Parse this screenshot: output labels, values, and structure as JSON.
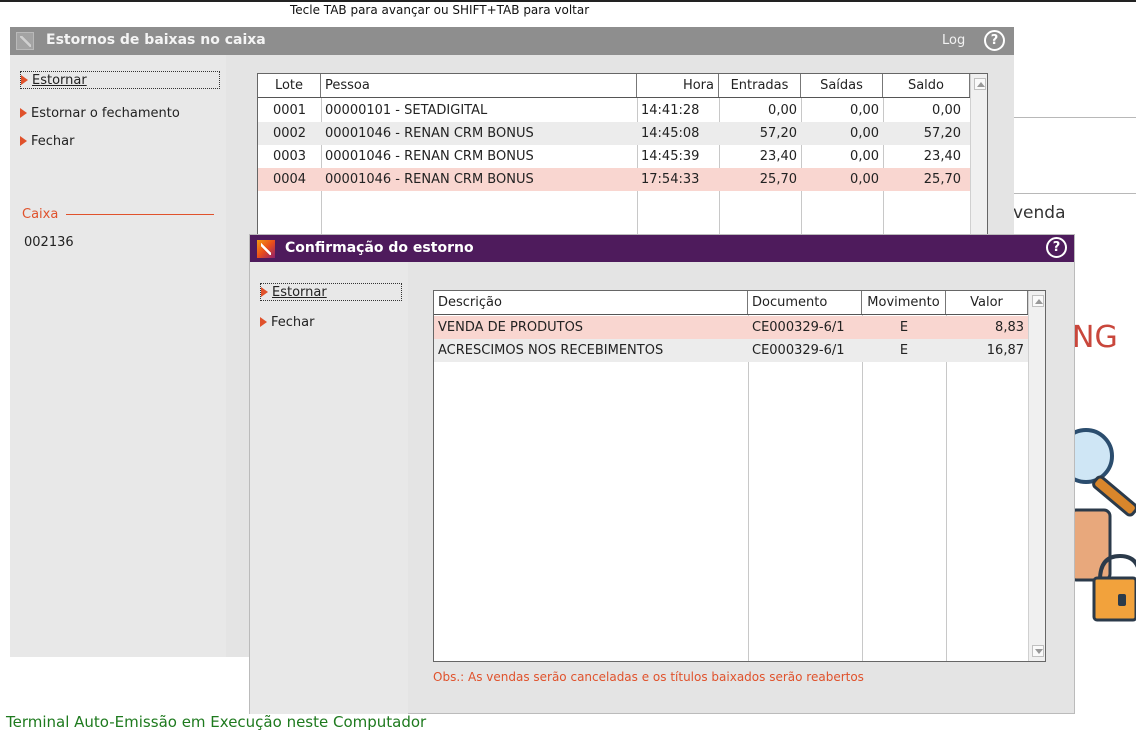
{
  "top_hint": "Tecle TAB para avançar ou SHIFT+TAB para voltar",
  "background": {
    "venda_text": "venda",
    "partial_heading": "NG"
  },
  "main_window": {
    "title": "Estornos de baixas no caixa",
    "log_label": "Log",
    "help_icon": "?",
    "menu": [
      {
        "label": "Estornar",
        "focused": true
      },
      {
        "label": "Estornar o fechamento",
        "focused": false
      },
      {
        "label": "Fechar",
        "focused": false
      }
    ],
    "caixa_label": "Caixa",
    "caixa_value": "002136",
    "grid": {
      "columns": [
        "Lote",
        "Pessoa",
        "Hora",
        "Entradas",
        "Saídas",
        "Saldo"
      ],
      "rows": [
        {
          "lote": "0001",
          "pessoa": "00000101 - SETADIGITAL",
          "hora": "14:41:28",
          "entradas": "0,00",
          "saidas": "0,00",
          "saldo": "0,00"
        },
        {
          "lote": "0002",
          "pessoa": "00001046 - RENAN CRM BONUS",
          "hora": "14:45:08",
          "entradas": "57,20",
          "saidas": "0,00",
          "saldo": "57,20"
        },
        {
          "lote": "0003",
          "pessoa": "00001046 - RENAN CRM BONUS",
          "hora": "14:45:39",
          "entradas": "23,40",
          "saidas": "0,00",
          "saldo": "23,40"
        },
        {
          "lote": "0004",
          "pessoa": "00001046 - RENAN CRM BONUS",
          "hora": "17:54:33",
          "entradas": "25,70",
          "saidas": "0,00",
          "saldo": "25,70"
        }
      ]
    }
  },
  "confirm_dialog": {
    "title": "Confirmação do estorno",
    "help_icon": "?",
    "menu": [
      {
        "label": "Estornar",
        "focused": true
      },
      {
        "label": "Fechar",
        "focused": false
      }
    ],
    "grid": {
      "columns": [
        "Descrição",
        "Documento",
        "Movimento",
        "Valor"
      ],
      "rows": [
        {
          "descricao": "VENDA DE PRODUTOS",
          "documento": "CE000329-6/1",
          "movimento": "E",
          "valor": "8,83"
        },
        {
          "descricao": "ACRESCIMOS NOS RECEBIMENTOS",
          "documento": "CE000329-6/1",
          "movimento": "E",
          "valor": "16,87"
        }
      ]
    },
    "obs": "Obs.: As vendas serão canceladas e os títulos baixados serão reabertos"
  },
  "footer_status": "Terminal Auto-Emissão em Execução neste Computador",
  "colors": {
    "accent_orange": "#e0522c",
    "dialog_titlebar": "#4e1b5c",
    "main_titlebar": "#8e8e8e",
    "selected_row": "#f9d6d0",
    "status_green": "#1e7a1e"
  }
}
